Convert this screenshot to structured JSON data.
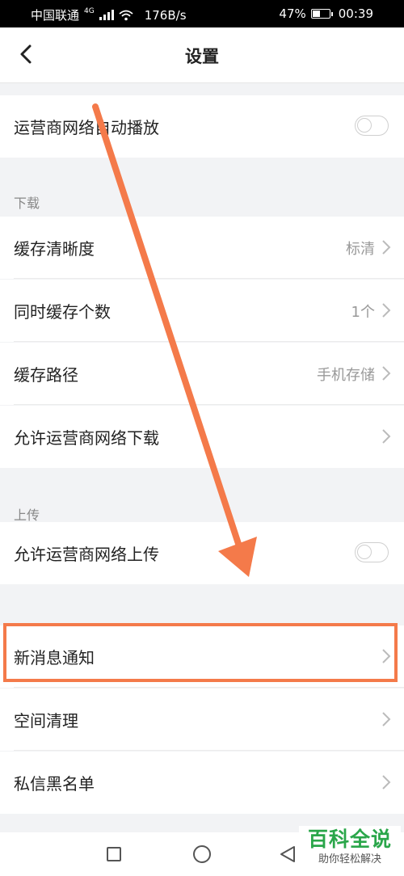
{
  "status_bar": {
    "carrier": "中国联通",
    "network_type": "4G",
    "speed": "176B/s",
    "battery": "47%",
    "battery_level": 0.47,
    "time": "00:39"
  },
  "header": {
    "title": "设置",
    "back_icon": "chevron-left-icon"
  },
  "rows": {
    "carrier_autoplay": {
      "label": "运营商网络自动播放",
      "toggle_on": false
    }
  },
  "download_section": {
    "title": "下载",
    "items": [
      {
        "label": "缓存清晰度",
        "value": "标清"
      },
      {
        "label": "同时缓存个数",
        "value": "1个"
      },
      {
        "label": "缓存路径",
        "value": "手机存储"
      },
      {
        "label": "允许运营商网络下载",
        "value": ""
      }
    ]
  },
  "upload_section": {
    "title": "上传",
    "items": [
      {
        "label": "允许运营商网络上传",
        "toggle_on": false
      }
    ]
  },
  "other_items": [
    {
      "label": "新消息通知"
    },
    {
      "label": "空间清理"
    },
    {
      "label": "私信黑名单"
    }
  ],
  "annotation": {
    "color": "#f47a4a"
  },
  "watermark": {
    "main": "百科全说",
    "sub": "助你轻松解决",
    "color": "#2aa64a"
  },
  "nav_icons": [
    "recent-apps-icon",
    "home-icon",
    "back-triangle-icon"
  ]
}
